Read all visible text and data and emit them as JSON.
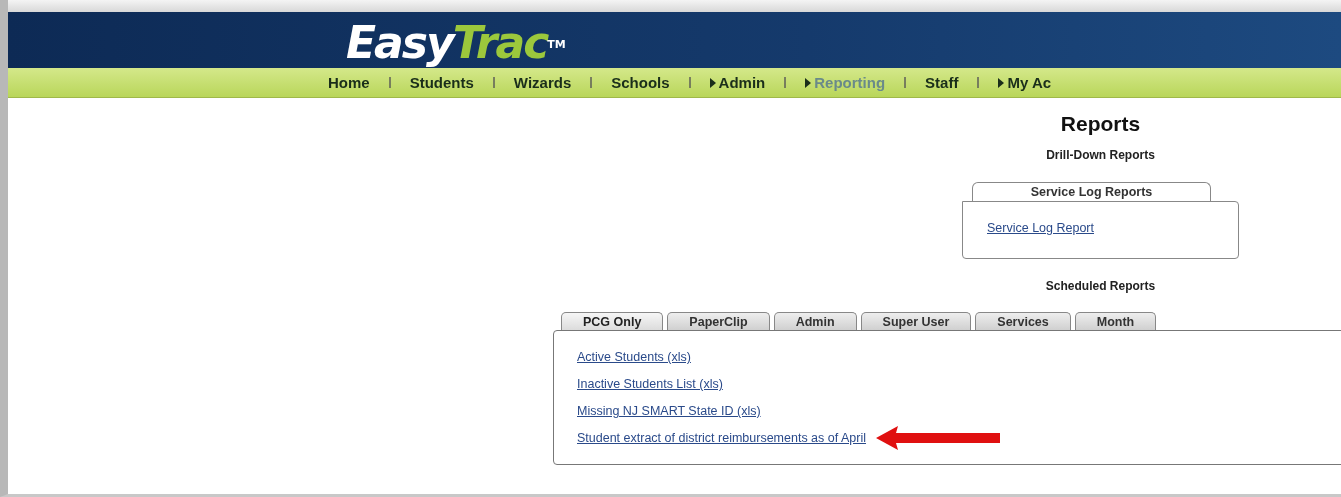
{
  "logo": {
    "first": "Easy",
    "second": "Trac",
    "mark": "TM"
  },
  "nav": [
    {
      "label": "Home",
      "arrow": false,
      "selected": false
    },
    {
      "label": "Students",
      "arrow": false,
      "selected": false
    },
    {
      "label": "Wizards",
      "arrow": false,
      "selected": false
    },
    {
      "label": "Schools",
      "arrow": false,
      "selected": false
    },
    {
      "label": "Admin",
      "arrow": true,
      "selected": false
    },
    {
      "label": "Reporting",
      "arrow": true,
      "selected": true
    },
    {
      "label": "Staff",
      "arrow": false,
      "selected": false
    },
    {
      "label": "My Ac",
      "arrow": true,
      "selected": false
    }
  ],
  "title": "Reports",
  "drill_down": {
    "heading": "Drill-Down Reports",
    "panel_title": "Service Log Reports",
    "links": [
      "Service Log Report"
    ]
  },
  "scheduled": {
    "heading": "Scheduled Reports",
    "tabs": [
      {
        "label": "PCG Only",
        "selected": true
      },
      {
        "label": "PaperClip",
        "selected": false
      },
      {
        "label": "Admin",
        "selected": false
      },
      {
        "label": "Super User",
        "selected": false
      },
      {
        "label": "Services",
        "selected": false
      },
      {
        "label": "Month",
        "selected": false
      }
    ],
    "links": [
      {
        "label": "Active Students (xls)",
        "highlighted": false
      },
      {
        "label": "Inactive Students List (xls)",
        "highlighted": false
      },
      {
        "label": "Missing NJ SMART State ID (xls)",
        "highlighted": false
      },
      {
        "label": "Student extract of district reimbursements as of April",
        "highlighted": true
      }
    ]
  }
}
